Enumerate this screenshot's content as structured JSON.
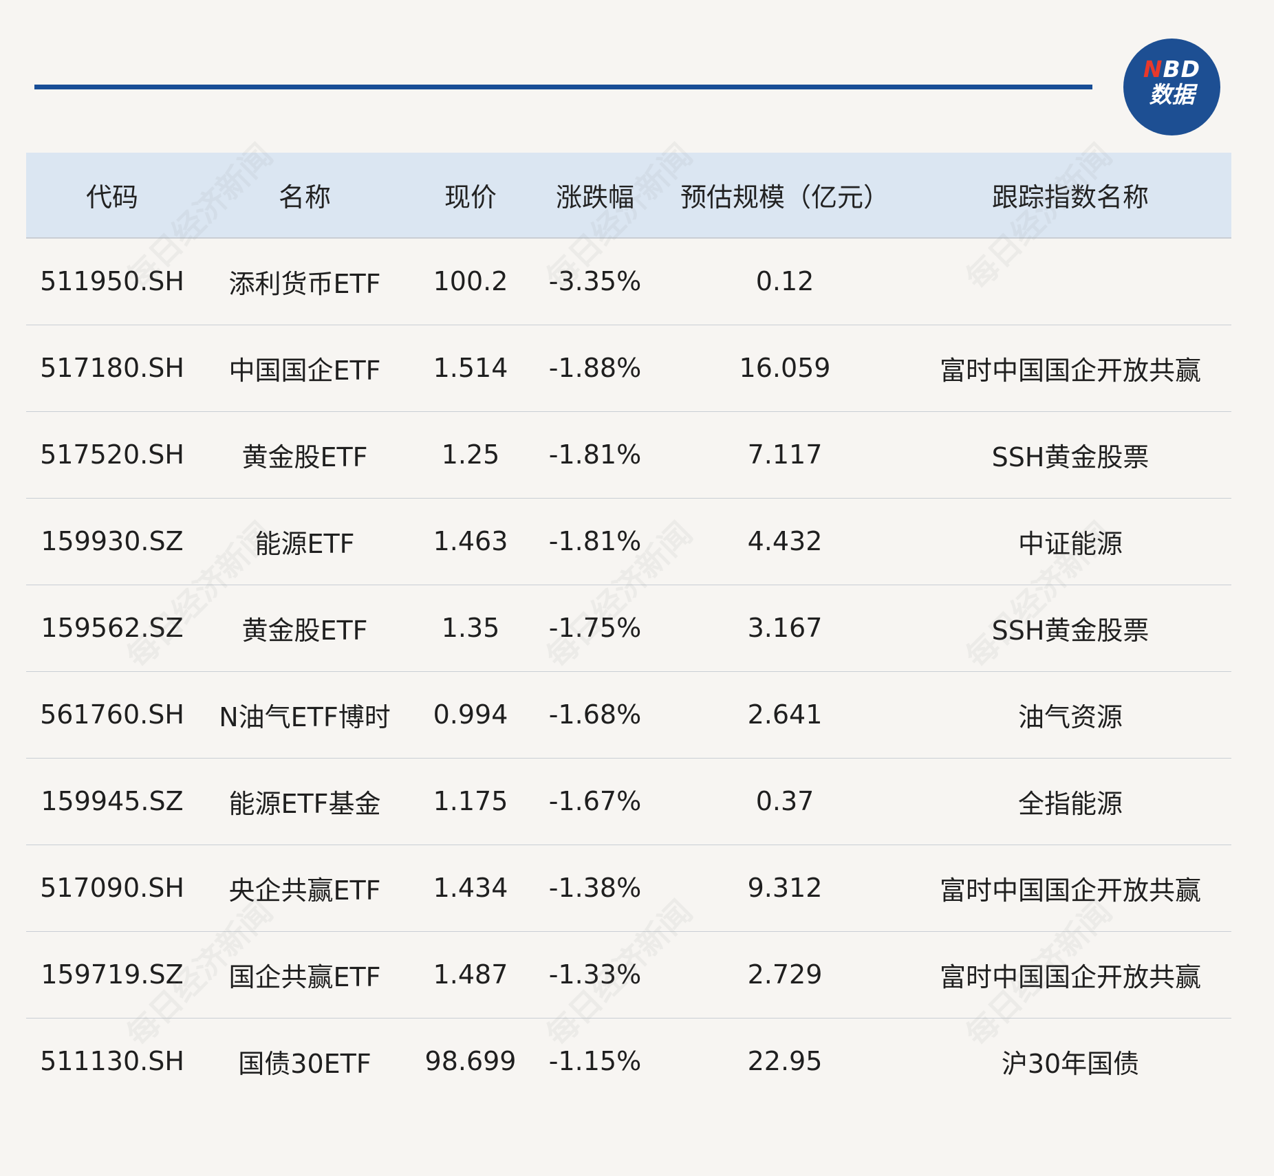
{
  "logo": {
    "top_n": "N",
    "top_rest": "BD",
    "bottom": "数据"
  },
  "watermark_text": "每日经济新闻",
  "colors": {
    "rule": "#184d96",
    "header_bg": "#dbe6f2",
    "logo_bg": "#1d4f93",
    "logo_accent": "#e8382b",
    "page_bg": "#f7f5f2"
  },
  "chart_data": {
    "type": "table",
    "columns": [
      "代码",
      "名称",
      "现价",
      "涨跌幅",
      "预估规模（亿元）",
      "跟踪指数名称"
    ],
    "rows": [
      [
        "511950.SH",
        "添利货币ETF",
        "100.2",
        "-3.35%",
        "0.12",
        ""
      ],
      [
        "517180.SH",
        "中国国企ETF",
        "1.514",
        "-1.88%",
        "16.059",
        "富时中国国企开放共赢"
      ],
      [
        "517520.SH",
        "黄金股ETF",
        "1.25",
        "-1.81%",
        "7.117",
        "SSH黄金股票"
      ],
      [
        "159930.SZ",
        "能源ETF",
        "1.463",
        "-1.81%",
        "4.432",
        "中证能源"
      ],
      [
        "159562.SZ",
        "黄金股ETF",
        "1.35",
        "-1.75%",
        "3.167",
        "SSH黄金股票"
      ],
      [
        "561760.SH",
        "N油气ETF博时",
        "0.994",
        "-1.68%",
        "2.641",
        "油气资源"
      ],
      [
        "159945.SZ",
        "能源ETF基金",
        "1.175",
        "-1.67%",
        "0.37",
        "全指能源"
      ],
      [
        "517090.SH",
        "央企共赢ETF",
        "1.434",
        "-1.38%",
        "9.312",
        "富时中国国企开放共赢"
      ],
      [
        "159719.SZ",
        "国企共赢ETF",
        "1.487",
        "-1.33%",
        "2.729",
        "富时中国国企开放共赢"
      ],
      [
        "511130.SH",
        "国债30ETF",
        "98.699",
        "-1.15%",
        "22.95",
        "沪30年国债"
      ]
    ]
  }
}
